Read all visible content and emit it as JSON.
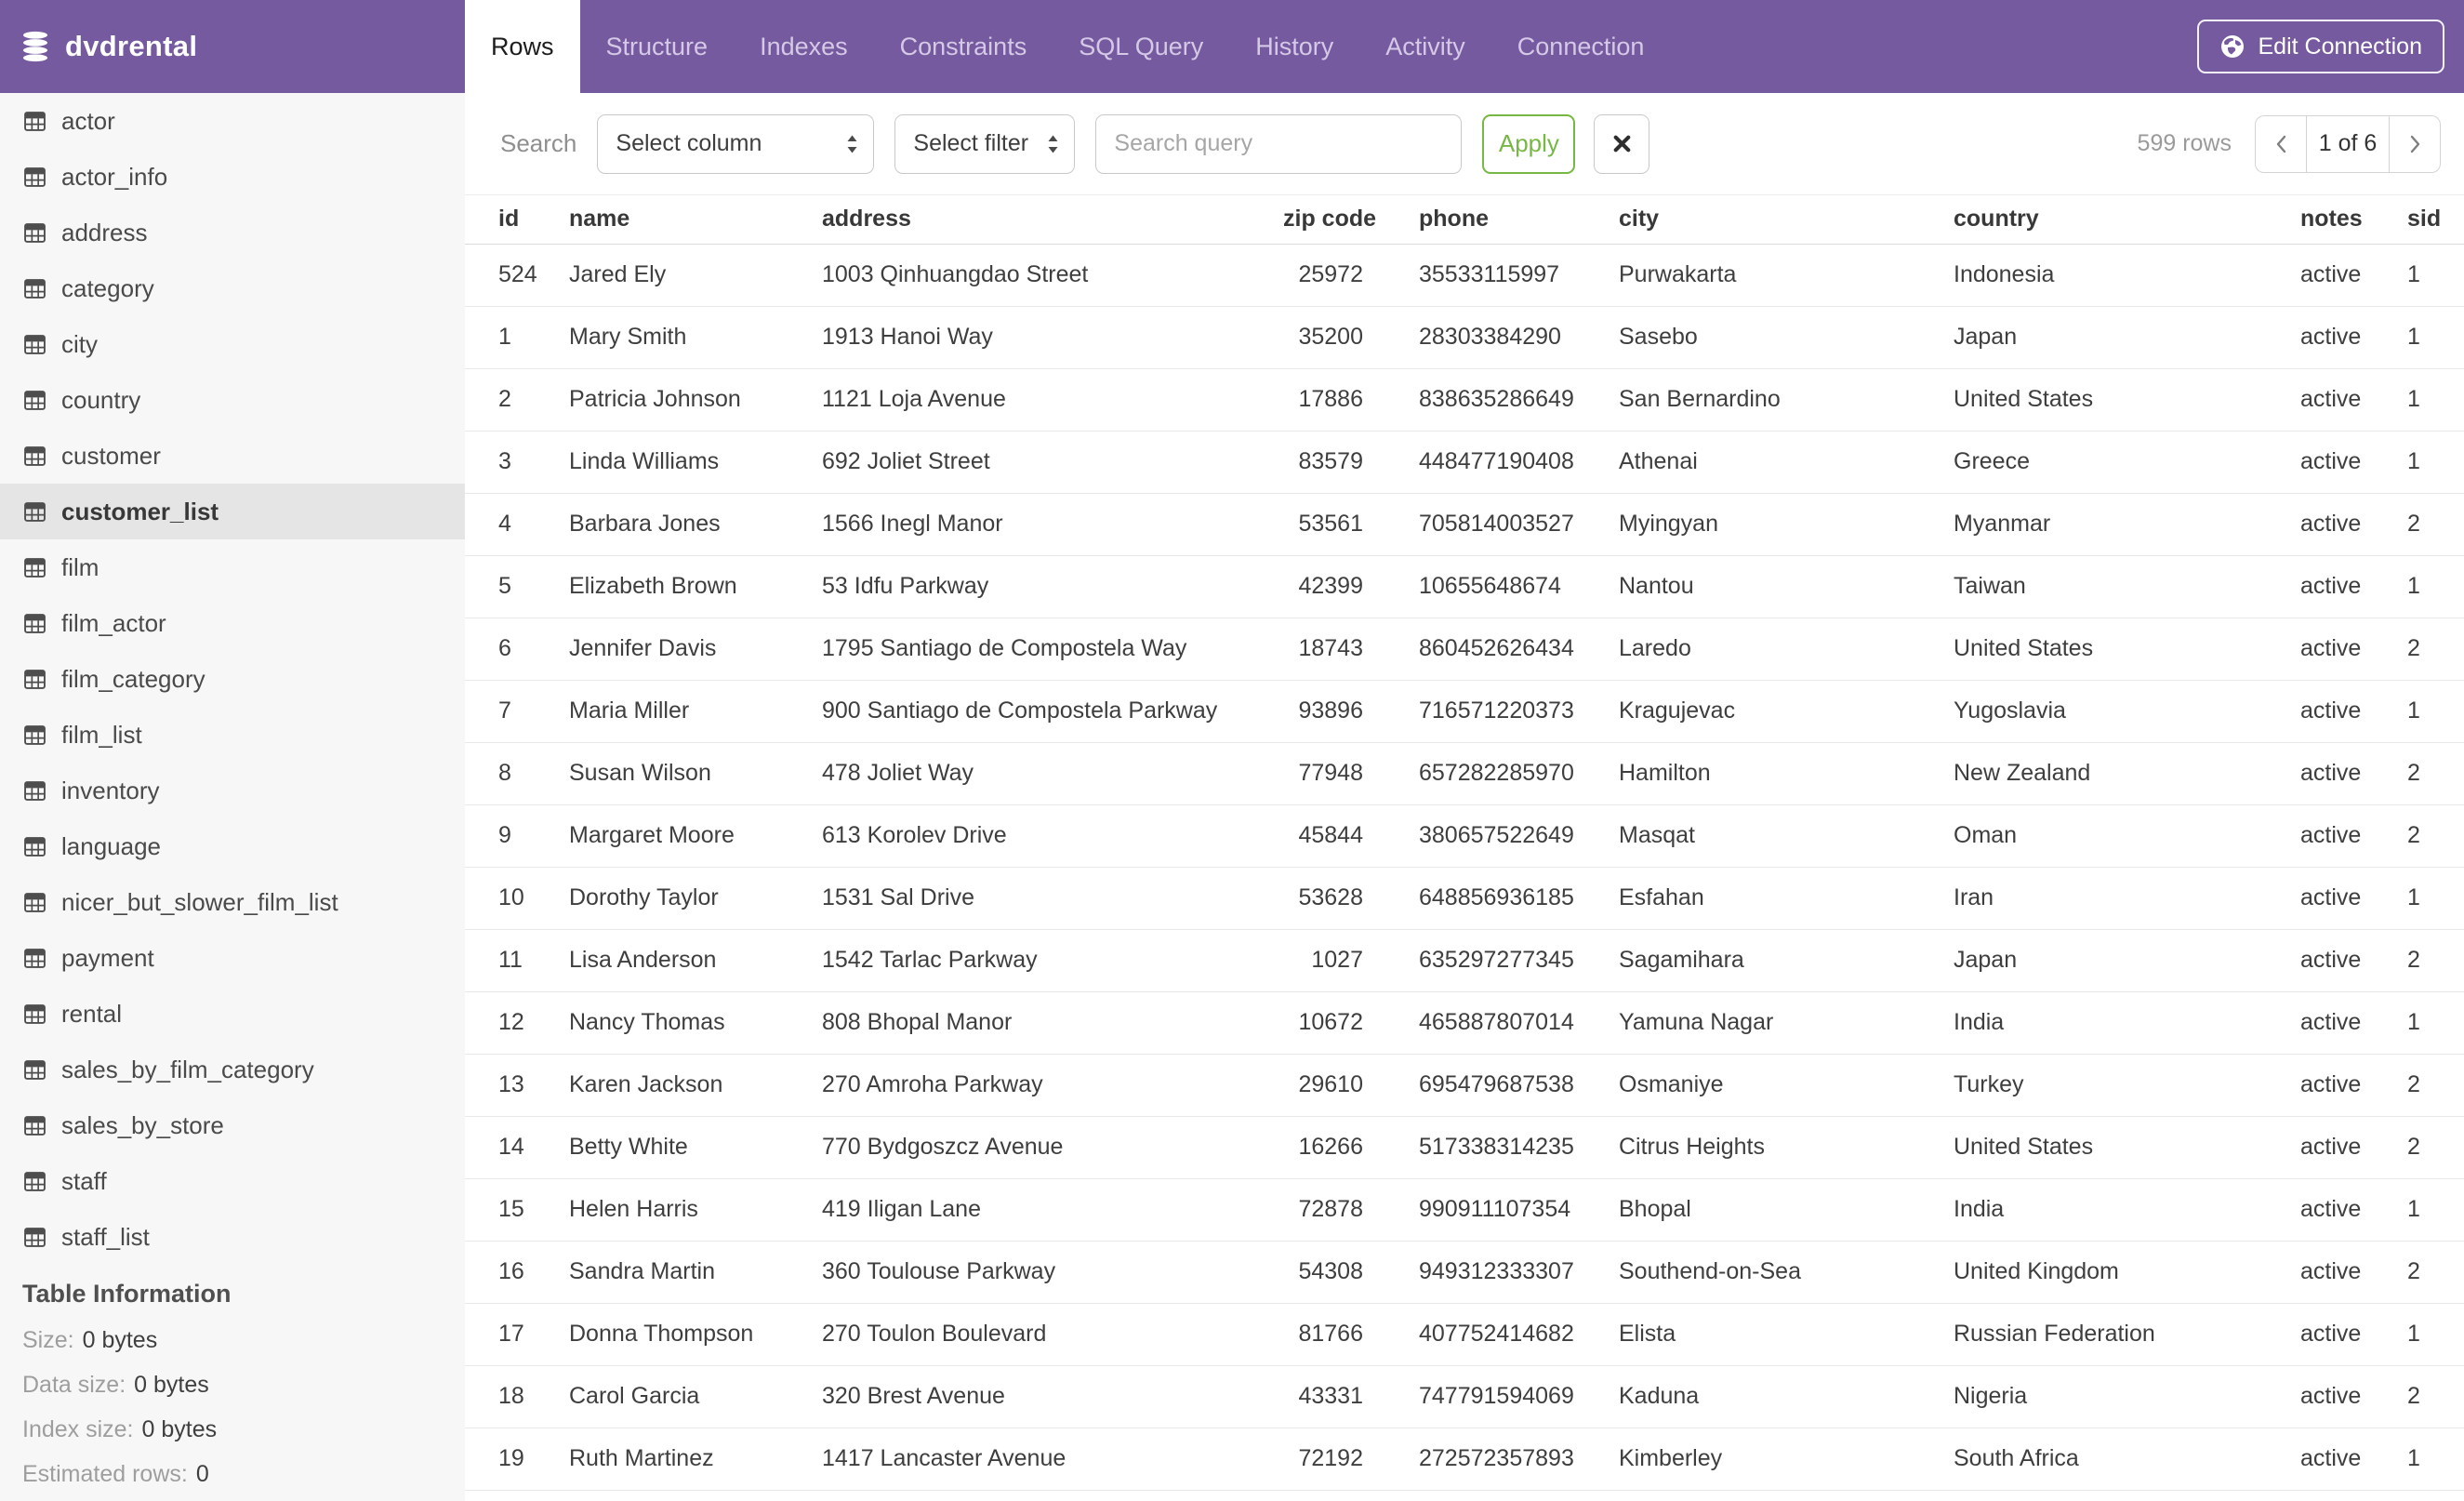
{
  "colors": {
    "accent_purple": "#765A9F",
    "accent_green": "#76B843",
    "selected_row_gray": "#E5E5E5"
  },
  "app": {
    "title": "dvdrental"
  },
  "header": {
    "tabs": [
      {
        "label": "Rows",
        "active": true
      },
      {
        "label": "Structure",
        "active": false
      },
      {
        "label": "Indexes",
        "active": false
      },
      {
        "label": "Constraints",
        "active": false
      },
      {
        "label": "SQL Query",
        "active": false
      },
      {
        "label": "History",
        "active": false
      },
      {
        "label": "Activity",
        "active": false
      },
      {
        "label": "Connection",
        "active": false
      }
    ],
    "edit_connection_label": "Edit Connection"
  },
  "sidebar": {
    "tables": [
      "actor",
      "actor_info",
      "address",
      "category",
      "city",
      "country",
      "customer",
      "customer_list",
      "film",
      "film_actor",
      "film_category",
      "film_list",
      "inventory",
      "language",
      "nicer_but_slower_film_list",
      "payment",
      "rental",
      "sales_by_film_category",
      "sales_by_store",
      "staff",
      "staff_list"
    ],
    "selected_table": "customer_list",
    "table_information": {
      "heading": "Table Information",
      "fields": [
        {
          "label": "Size:",
          "value": "0 bytes"
        },
        {
          "label": "Data size:",
          "value": "0 bytes"
        },
        {
          "label": "Index size:",
          "value": "0 bytes"
        },
        {
          "label": "Estimated rows:",
          "value": "0"
        }
      ]
    }
  },
  "toolbar": {
    "search_label": "Search",
    "column_select": "Select column",
    "filter_select": "Select filter",
    "query_placeholder": "Search query",
    "apply_label": "Apply",
    "rows_count": "599 rows",
    "pagination": {
      "current": "1 of 6"
    }
  },
  "table": {
    "columns": [
      {
        "label": "id",
        "align": "left"
      },
      {
        "label": "name",
        "align": "left"
      },
      {
        "label": "address",
        "align": "left"
      },
      {
        "label": "zip code",
        "align": "right"
      },
      {
        "label": "phone",
        "align": "left"
      },
      {
        "label": "city",
        "align": "left"
      },
      {
        "label": "country",
        "align": "left"
      },
      {
        "label": "notes",
        "align": "left"
      },
      {
        "label": "sid",
        "align": "left"
      }
    ],
    "rows": [
      [
        "524",
        "Jared Ely",
        "1003 Qinhuangdao Street",
        "25972",
        "35533115997",
        "Purwakarta",
        "Indonesia",
        "active",
        "1"
      ],
      [
        "1",
        "Mary Smith",
        "1913 Hanoi Way",
        "35200",
        "28303384290",
        "Sasebo",
        "Japan",
        "active",
        "1"
      ],
      [
        "2",
        "Patricia Johnson",
        "1121 Loja Avenue",
        "17886",
        "838635286649",
        "San Bernardino",
        "United States",
        "active",
        "1"
      ],
      [
        "3",
        "Linda Williams",
        "692 Joliet Street",
        "83579",
        "448477190408",
        "Athenai",
        "Greece",
        "active",
        "1"
      ],
      [
        "4",
        "Barbara Jones",
        "1566 Inegl Manor",
        "53561",
        "705814003527",
        "Myingyan",
        "Myanmar",
        "active",
        "2"
      ],
      [
        "5",
        "Elizabeth Brown",
        "53 Idfu Parkway",
        "42399",
        "10655648674",
        "Nantou",
        "Taiwan",
        "active",
        "1"
      ],
      [
        "6",
        "Jennifer Davis",
        "1795 Santiago de Compostela Way",
        "18743",
        "860452626434",
        "Laredo",
        "United States",
        "active",
        "2"
      ],
      [
        "7",
        "Maria Miller",
        "900 Santiago de Compostela Parkway",
        "93896",
        "716571220373",
        "Kragujevac",
        "Yugoslavia",
        "active",
        "1"
      ],
      [
        "8",
        "Susan Wilson",
        "478 Joliet Way",
        "77948",
        "657282285970",
        "Hamilton",
        "New Zealand",
        "active",
        "2"
      ],
      [
        "9",
        "Margaret Moore",
        "613 Korolev Drive",
        "45844",
        "380657522649",
        "Masqat",
        "Oman",
        "active",
        "2"
      ],
      [
        "10",
        "Dorothy Taylor",
        "1531 Sal Drive",
        "53628",
        "648856936185",
        "Esfahan",
        "Iran",
        "active",
        "1"
      ],
      [
        "11",
        "Lisa Anderson",
        "1542 Tarlac Parkway",
        "1027",
        "635297277345",
        "Sagamihara",
        "Japan",
        "active",
        "2"
      ],
      [
        "12",
        "Nancy Thomas",
        "808 Bhopal Manor",
        "10672",
        "465887807014",
        "Yamuna Nagar",
        "India",
        "active",
        "1"
      ],
      [
        "13",
        "Karen Jackson",
        "270 Amroha Parkway",
        "29610",
        "695479687538",
        "Osmaniye",
        "Turkey",
        "active",
        "2"
      ],
      [
        "14",
        "Betty White",
        "770 Bydgoszcz Avenue",
        "16266",
        "517338314235",
        "Citrus Heights",
        "United States",
        "active",
        "2"
      ],
      [
        "15",
        "Helen Harris",
        "419 Iligan Lane",
        "72878",
        "990911107354",
        "Bhopal",
        "India",
        "active",
        "1"
      ],
      [
        "16",
        "Sandra Martin",
        "360 Toulouse Parkway",
        "54308",
        "949312333307",
        "Southend-on-Sea",
        "United Kingdom",
        "active",
        "2"
      ],
      [
        "17",
        "Donna Thompson",
        "270 Toulon Boulevard",
        "81766",
        "407752414682",
        "Elista",
        "Russian Federation",
        "active",
        "1"
      ],
      [
        "18",
        "Carol Garcia",
        "320 Brest Avenue",
        "43331",
        "747791594069",
        "Kaduna",
        "Nigeria",
        "active",
        "2"
      ],
      [
        "19",
        "Ruth Martinez",
        "1417 Lancaster Avenue",
        "72192",
        "272572357893",
        "Kimberley",
        "South Africa",
        "active",
        "1"
      ]
    ]
  }
}
